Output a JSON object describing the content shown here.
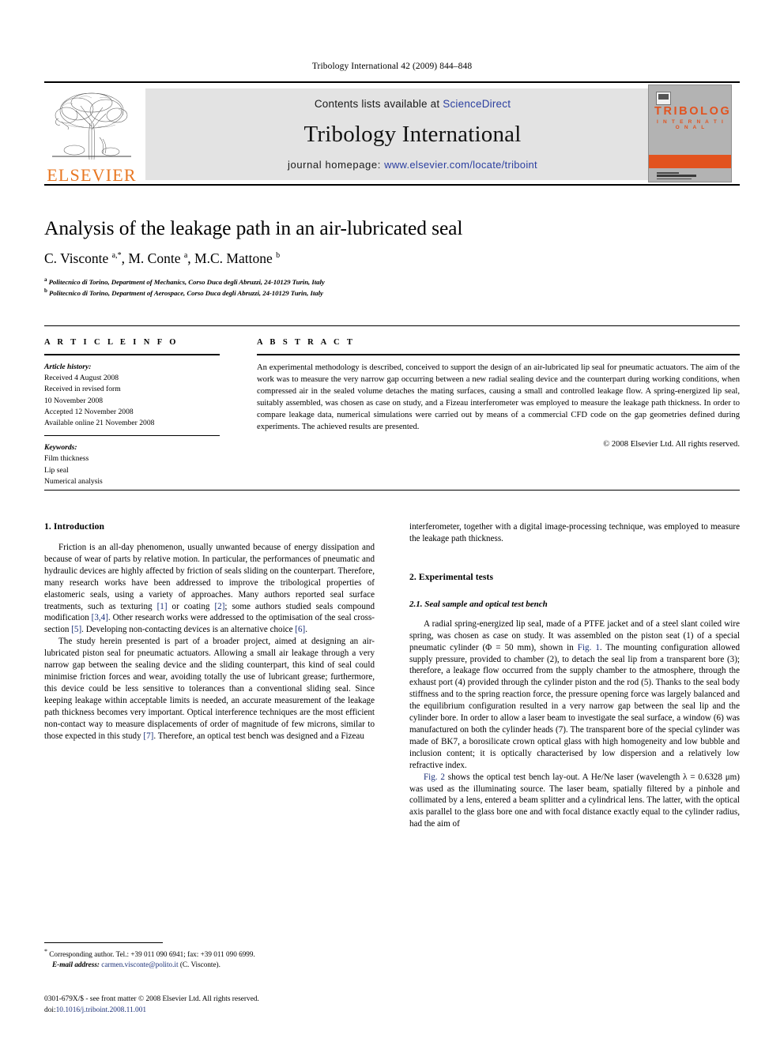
{
  "running_head": "Tribology International 42 (2009) 844–848",
  "masthead": {
    "contents_prefix": "Contents lists available at ",
    "sciencedirect": "ScienceDirect",
    "journal_title": "Tribology International",
    "homepage_prefix": "journal homepage: ",
    "homepage_url": "www.elsevier.com/locate/triboint",
    "publisher_name": "ELSEVIER",
    "cover_line1": "TRIBOLOGY",
    "cover_line2": "I N T E R N A T I O N A L",
    "accent_orange": "#E2531F",
    "link_blue": "#2b3fa0"
  },
  "title": "Analysis of the leakage path in an air-lubricated seal",
  "authors_html": "C. Visconte <sup>a,*</sup>, M. Conte <sup>a</sup>, M.C. Mattone <sup>b</sup>",
  "affiliations": [
    "Politecnico di Torino, Department of Mechanics, Corso Duca degli Abruzzi, 24-10129 Turin, Italy",
    "Politecnico di Torino, Department of Aerospace, Corso Duca degli Abruzzi, 24-10129 Turin, Italy"
  ],
  "article_info": {
    "heading": "A R T I C L E  I N F O",
    "history_label": "Article history:",
    "history": [
      "Received 4 August 2008",
      "Received in revised form",
      "10 November 2008",
      "Accepted 12 November 2008",
      "Available online 21 November 2008"
    ],
    "keywords_label": "Keywords:",
    "keywords": [
      "Film thickness",
      "Lip seal",
      "Numerical analysis"
    ]
  },
  "abstract": {
    "heading": "A B S T R A C T",
    "text": "An experimental methodology is described, conceived to support the design of an air-lubricated lip seal for pneumatic actuators. The aim of the work was to measure the very narrow gap occurring between a new radial sealing device and the counterpart during working conditions, when compressed air in the sealed volume detaches the mating surfaces, causing a small and controlled leakage flow. A spring-energized lip seal, suitably assembled, was chosen as case on study, and a Fizeau interferometer was employed to measure the leakage path thickness. In order to compare leakage data, numerical simulations were carried out by means of a commercial CFD code on the gap geometries defined during experiments. The achieved results are presented.",
    "copyright": "© 2008 Elsevier Ltd. All rights reserved."
  },
  "body": {
    "intro_heading": "1. Introduction",
    "intro_p1": "Friction is an all-day phenomenon, usually unwanted because of energy dissipation and because of wear of parts by relative motion. In particular, the performances of pneumatic and hydraulic devices are highly affected by friction of seals sliding on the counterpart. Therefore, many research works have been addressed to improve the tribological properties of elastomeric seals, using a variety of approaches. Many authors reported seal surface treatments, such as texturing [1] or coating [2]; some authors studied seals compound modification [3,4]. Other research works were addressed to the optimisation of the seal cross-section [5]. Developing non-contacting devices is an alternative choice [6].",
    "intro_p2": "The study herein presented is part of a broader project, aimed at designing an air-lubricated piston seal for pneumatic actuators. Allowing a small air leakage through a very narrow gap between the sealing device and the sliding counterpart, this kind of seal could minimise friction forces and wear, avoiding totally the use of lubricant grease; furthermore, this device could be less sensitive to tolerances than a conventional sliding seal. Since keeping leakage within acceptable limits is needed, an accurate measurement of the leakage path thickness becomes very important. Optical interference techniques are the most efficient non-contact way to measure displacements of order of magnitude of few microns, similar to those expected in this study [7]. Therefore, an optical test bench was designed and a Fizeau",
    "right_continuation": "interferometer, together with a digital image-processing technique, was employed to measure the leakage path thickness.",
    "exp_heading": "2. Experimental tests",
    "exp_sub_heading": "2.1. Seal sample and optical test bench",
    "exp_p1": "A radial spring-energized lip seal, made of a PTFE jacket and of a steel slant coiled wire spring, was chosen as case on study. It was assembled on the piston seat (1) of a special pneumatic cylinder (Φ = 50 mm), shown in Fig. 1. The mounting configuration allowed supply pressure, provided to chamber (2), to detach the seal lip from a transparent bore (3); therefore, a leakage flow occurred from the supply chamber to the atmosphere, through the exhaust port (4) provided through the cylinder piston and the rod (5). Thanks to the seal body stiffness and to the spring reaction force, the pressure opening force was largely balanced and the equilibrium configuration resulted in a very narrow gap between the seal lip and the cylinder bore. In order to allow a laser beam to investigate the seal surface, a window (6) was manufactured on both the cylinder heads (7). The transparent bore of the special cylinder was made of BK7, a borosilicate crown optical glass with high homogeneity and low bubble and inclusion content; it is optically characterised by low dispersion and a relatively low refractive index.",
    "exp_p2": "Fig. 2 shows the optical test bench lay-out. A He/Ne laser (wavelength λ = 0.6328 μm) was used as the illuminating source. The laser beam, spatially filtered by a pinhole and collimated by a lens, entered a beam splitter and a cylindrical lens. The latter, with the optical axis parallel to the glass bore one and with focal distance exactly equal to the cylinder radius, had the aim of",
    "ref_links": [
      "[1]",
      "[2]",
      "[3,4]",
      "[5]",
      "[6]",
      "[7]",
      "Fig. 1",
      "Fig. 2"
    ]
  },
  "footnotes": {
    "corresponding": "Corresponding author. Tel.: +39 011 090 6941; fax: +39 011 090 6999.",
    "email_label": "E-mail address:",
    "email": "carmen.visconte@polito.it",
    "email_suffix": "(C. Visconte).",
    "imprint": "0301-679X/$ - see front matter © 2008 Elsevier Ltd. All rights reserved.",
    "doi_label": "doi:",
    "doi": "10.1016/j.triboint.2008.11.001"
  }
}
